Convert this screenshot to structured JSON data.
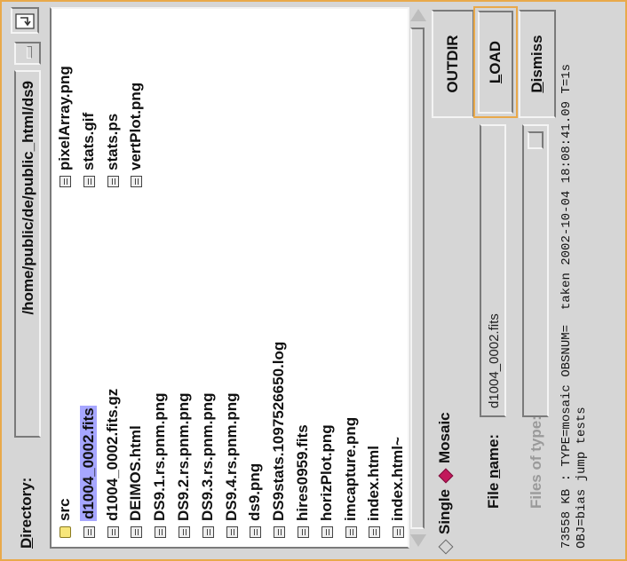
{
  "directory": {
    "label_pre": "",
    "label_u": "D",
    "label_post": "irectory:",
    "path": "/home/public/de/public_html/ds9"
  },
  "files_col1": [
    {
      "name": "src",
      "type": "folder"
    },
    {
      "name": "d1004_0002.fits",
      "type": "file",
      "selected": true
    },
    {
      "name": "d1004_0002.fits.gz",
      "type": "file"
    },
    {
      "name": "DEIMOS.html",
      "type": "file"
    },
    {
      "name": "DS9.1.rs.pnm.png",
      "type": "file"
    },
    {
      "name": "DS9.2.rs.pnm.png",
      "type": "file"
    },
    {
      "name": "DS9.3.rs.pnm.png",
      "type": "file"
    },
    {
      "name": "DS9.4.rs.pnm.png",
      "type": "file"
    },
    {
      "name": "ds9.png",
      "type": "file"
    },
    {
      "name": "DS9stats.1097526650.log",
      "type": "file"
    },
    {
      "name": "hires0959.fits",
      "type": "file"
    },
    {
      "name": "horizPlot.png",
      "type": "file"
    },
    {
      "name": "imcapture.png",
      "type": "file"
    },
    {
      "name": "index.html",
      "type": "file"
    },
    {
      "name": "index.html~",
      "type": "file"
    }
  ],
  "files_col2": [
    {
      "name": "pixelArray.png",
      "type": "file"
    },
    {
      "name": "stats.gif",
      "type": "file"
    },
    {
      "name": "stats.ps",
      "type": "file"
    },
    {
      "name": "vertPlot.png",
      "type": "file"
    }
  ],
  "mode": {
    "single": "Single",
    "mosaic": "Mosaic",
    "selected": "mosaic"
  },
  "filename": {
    "label_pre": "File ",
    "label_u": "n",
    "label_post": "ame:",
    "value": "d1004_0002.fits"
  },
  "filetype": {
    "label": "Files of type:",
    "value": ""
  },
  "buttons": {
    "outdir": "OUTDIR",
    "load_u": "L",
    "load_rest": "OAD",
    "dismiss_u": "D",
    "dismiss_rest": "ismiss"
  },
  "status": {
    "line1": "73558 KB : TYPE=mosaic OBSNUM=  taken 2002-10-04 18:08:41.09 T=1s",
    "line2": "OBJ=bias jump tests"
  },
  "colors": {
    "accent": "#e9a94b",
    "selection": "#a6a6ff",
    "radio_on": "#c2185b",
    "folder": "#f7e67a"
  }
}
